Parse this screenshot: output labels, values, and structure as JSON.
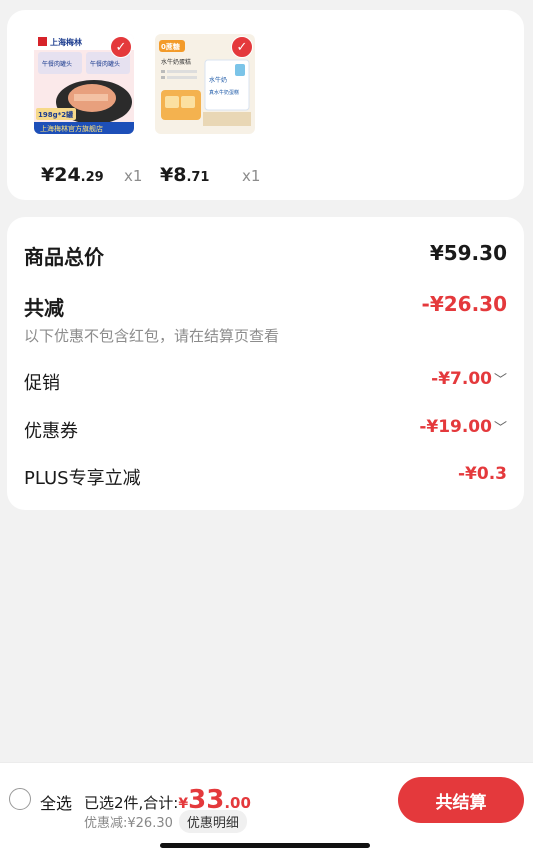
{
  "products": [
    {
      "price_int": "¥24",
      "price_dec": ".29",
      "qty": "x1",
      "badge_icon": "check-icon"
    },
    {
      "price_int": "¥8",
      "price_dec": ".71",
      "qty": "x1",
      "badge_icon": "check-icon"
    }
  ],
  "product1_image": {
    "brand": "上海梅林",
    "tag_left": "午餐肉罐头",
    "tag_right": "午餐肉罐头",
    "weight": "198g*2罐",
    "banner": "上海梅林官方旗舰店",
    "spec": "午餐肉罐头"
  },
  "product2_image": {
    "badge": "0蔗糖",
    "subtitle": "水牛奶蛋糕",
    "bag_label": "水牛奶",
    "box_text": "真水牛奶蛋糕"
  },
  "summary": {
    "total_label": "商品总价",
    "total_value": "¥59.30",
    "reduce_label": "共减",
    "reduce_value": "-¥26.30",
    "note": "以下优惠不包含红包，请在结算页查看",
    "promo_label": "促销",
    "promo_value": "-¥7.00",
    "coupon_label": "优惠券",
    "coupon_value": "-¥19.00",
    "plus_label": "PLUS专享立减",
    "plus_value": "-¥0.3"
  },
  "bottom_bar": {
    "select_all": "全选",
    "selected_text": "已选2件,合计:",
    "yen": "¥",
    "total_int": "33",
    "total_dec": ".00",
    "discount_text": "优惠减:¥26.30",
    "detail_button": "优惠明细",
    "checkout_button": "共结算"
  },
  "colors": {
    "accent": "#e4393c",
    "background": "#f2f2f2"
  }
}
